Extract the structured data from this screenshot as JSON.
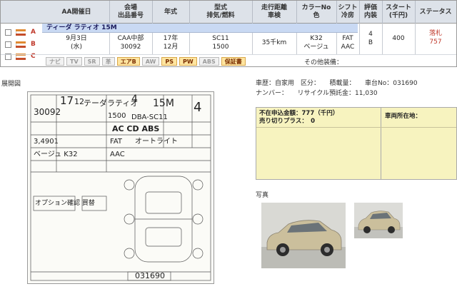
{
  "header": {
    "date_label": "AA開催日",
    "venue_label": [
      "会場",
      "出品番号"
    ],
    "year_label": "年式",
    "model_label": [
      "型式",
      "排気/燃料"
    ],
    "mileage_label": [
      "走行距離",
      "車検"
    ],
    "color_label": [
      "カラーNo",
      "色"
    ],
    "shift_label": [
      "シフト",
      "冷房"
    ],
    "score_label": [
      "評価",
      "内装"
    ],
    "start_label": [
      "スタート",
      "(千円)"
    ],
    "status_label": "ステータス"
  },
  "flag_letters": [
    "A",
    "B",
    "C"
  ],
  "flag_colors": {
    "a": "#e08a32",
    "b": "#ffffff",
    "c": "#c44d2a",
    "letter": "#c0392b"
  },
  "car": {
    "name": "ティーダ ラティオ 15M",
    "date": "9月3日",
    "weekday": "(水)",
    "venue": "CAA中部",
    "lot": "30092",
    "year": "17年",
    "month": "12月",
    "model": "SC11",
    "displacement": "1500",
    "mileage": "35千km",
    "color_no": "K32",
    "color": "ベージュ",
    "shift": "FAT",
    "ac": "AAC",
    "score": "4",
    "interior": "B",
    "start": "400",
    "status": "落札",
    "status_price": "757"
  },
  "equipment": [
    {
      "label": "ナビ",
      "on": false
    },
    {
      "label": "TV",
      "on": false
    },
    {
      "label": "SR",
      "on": false
    },
    {
      "label": "革",
      "on": false
    },
    {
      "label": "エアB",
      "on": true
    },
    {
      "label": "AW",
      "on": false
    },
    {
      "label": "PS",
      "on": true
    },
    {
      "label": "PW",
      "on": true
    },
    {
      "label": "ABS",
      "on": false
    },
    {
      "label": "保証書",
      "on": true
    }
  ],
  "other_equipment_label": "その他装備：",
  "sections": {
    "sheet_title": "展開図",
    "photos_title": "写真"
  },
  "info": {
    "line1": "車歴：自家用　区分：　　積載量：　　車台No：031690",
    "line2": "ナンバー：　　リサイクル預託金：11,030"
  },
  "price": {
    "unsold_label": "不在申込金額：777（千円）",
    "sell_label": "売り切りプラス：　0",
    "location_label": "車両所在地："
  },
  "sheet": {
    "lot": "30092",
    "year": "17",
    "month": "12",
    "name": "テーダラティオ",
    "grade": "15M",
    "score": "4",
    "interior": "4",
    "cc": "1500",
    "model": "DBA-SC11",
    "equip": "AC CD ABS",
    "color": "ベージュ K32",
    "shift": "FAT",
    "ac": "AAC",
    "light": "オートライト",
    "mileage": "3,4901",
    "chassis": "031690",
    "notes": "オプション確認 買替"
  },
  "colors": {
    "header_bg": "#dde2e9",
    "namebar_bg": "#c9d9f3",
    "price_bg": "#f7f3bf",
    "status_red": "#c0392b"
  }
}
